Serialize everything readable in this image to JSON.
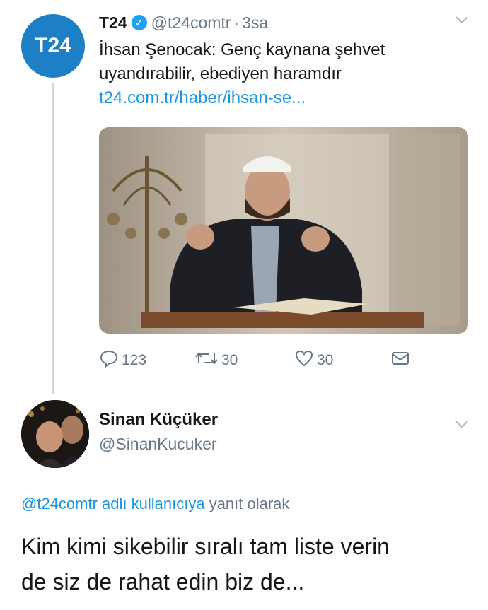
{
  "tweet": {
    "avatar_text": "T24",
    "name": "T24",
    "handle": "@t24comtr",
    "separator": "·",
    "time": "3sa",
    "text_line1": "İhsan Şenocak: Genç kaynana şehvet",
    "text_line2": "uyandırabilir, ebediyen haramdır",
    "link": "t24.com.tr/haber/ihsan-se...",
    "replies": "123",
    "retweets": "30",
    "likes": "30",
    "icons": {
      "reply": "reply-icon",
      "retweet": "retweet-icon",
      "like": "heart-icon",
      "dm": "envelope-icon",
      "menu": "chevron-down-icon",
      "verified": "verified-badge-icon"
    }
  },
  "reply": {
    "name": "Sinan Küçüker",
    "handle": "@SinanKucuker",
    "reply_to_mention": "@t24comtr adlı kullanıcıya",
    "reply_to_suffix": "yanıt olarak",
    "text_line1": "Kim kimi sikebilir sıralı tam liste verin",
    "text_line2": "de siz de rahat edin biz de..."
  },
  "colors": {
    "brand": "#1d7fc6",
    "link": "#1b95e0",
    "muted": "#657786"
  }
}
